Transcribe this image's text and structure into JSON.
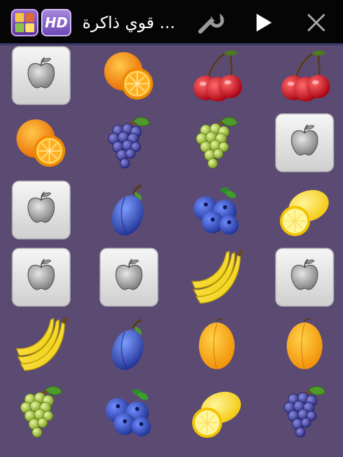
{
  "header": {
    "title": "قوي ذاكرة ...",
    "hd_label": "HD",
    "buttons": [
      "settings",
      "play",
      "close"
    ]
  },
  "board": {
    "columns": 4,
    "rows": 6,
    "cards": [
      [
        "hidden",
        "orange",
        "cherry",
        "cherry"
      ],
      [
        "orange",
        "blue-grapes",
        "green-grapes",
        "hidden"
      ],
      [
        "hidden",
        "plum",
        "blueberries",
        "lemon"
      ],
      [
        "hidden",
        "hidden",
        "banana",
        "hidden"
      ],
      [
        "banana",
        "plum",
        "apricot",
        "apricot"
      ],
      [
        "green-grapes",
        "blueberries",
        "lemon",
        "blue-grapes"
      ]
    ]
  },
  "colors": {
    "background": "#5b4b73",
    "topbar": "#050505",
    "card_face": "#e4e4e4"
  }
}
